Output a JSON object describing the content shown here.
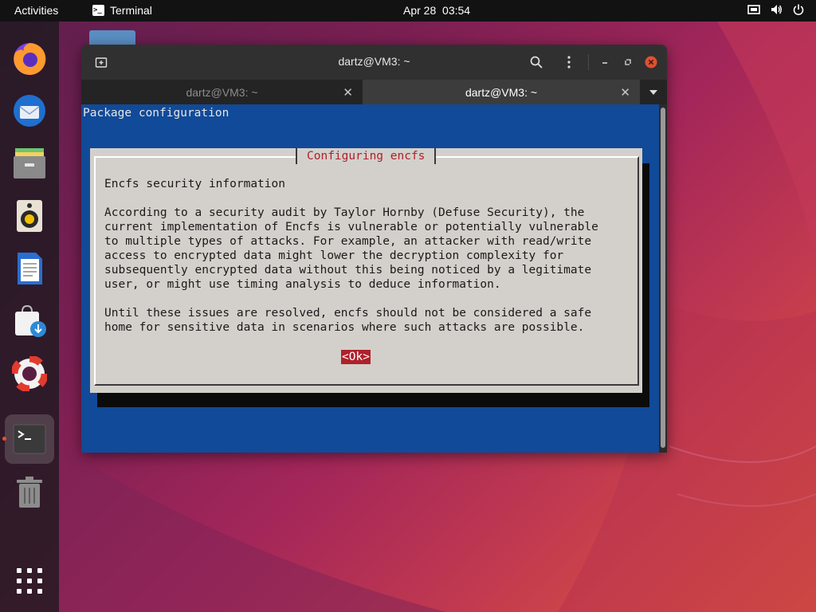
{
  "topbar": {
    "activities": "Activities",
    "app_name": "Terminal",
    "clock": "Apr 28  03:54",
    "tray_icons": [
      "network-icon",
      "volume-icon",
      "power-icon"
    ]
  },
  "dock": {
    "apps": [
      "Firefox",
      "Thunderbird",
      "Files",
      "Rhythmbox",
      "LibreOffice Writer",
      "Ubuntu Software",
      "Help",
      "Terminal",
      "Trash",
      "Show Applications"
    ],
    "accent_color": "#e95420"
  },
  "window": {
    "title": "dartz@VM3: ~",
    "tabs": [
      {
        "label": "dartz@VM3: ~",
        "active": false
      },
      {
        "label": "dartz@VM3: ~",
        "active": true
      }
    ]
  },
  "terminal": {
    "header": "Package configuration",
    "dialog": {
      "title": "Configuring encfs",
      "heading": "Encfs security information",
      "paragraph1": "According to a security audit by Taylor Hornby (Defuse Security), the\ncurrent implementation of Encfs is vulnerable or potentially vulnerable\nto multiple types of attacks. For example, an attacker with read/write\naccess to encrypted data might lower the decryption complexity for\nsubsequently encrypted data without this being noticed by a legitimate\nuser, or might use timing analysis to deduce information.",
      "paragraph2": "Until these issues are resolved, encfs should not be considered a safe\nhome for sensitive data in scenarios where such attacks are possible.",
      "ok_label": "<Ok>"
    },
    "background_color": "#114a98",
    "dialog_color": "#d3d0cb",
    "highlight_color": "#b0202c"
  }
}
